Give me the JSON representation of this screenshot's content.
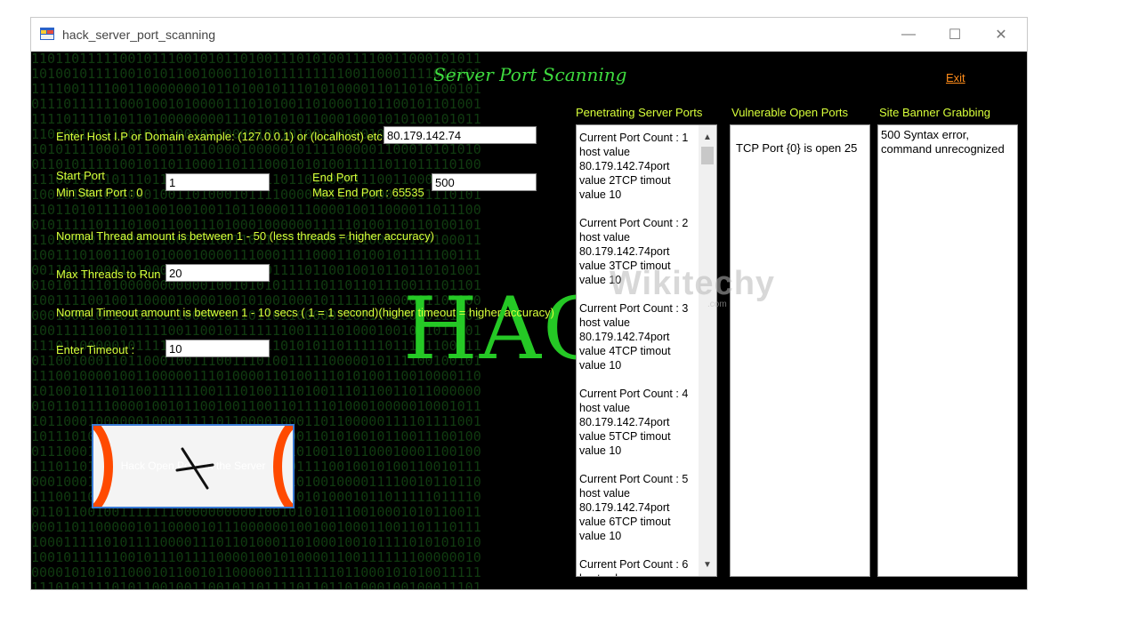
{
  "window": {
    "title": "hack_server_port_scanning",
    "minimize_glyph": "—",
    "maximize_glyph": "☐",
    "close_glyph": "✕",
    "icon": "app-icon"
  },
  "header": {
    "title": "Server Port Scanning",
    "exit_label": "Exit"
  },
  "form": {
    "host_label": "Enter Host I.P or Domain example: (127.0.0.1) or (localhost) etc..",
    "host_value": "80.179.142.74",
    "start_port_label": "Start Port",
    "start_port_hint": "Min Start Port : 0",
    "start_port_value": "1",
    "end_port_label": "End Port",
    "end_port_hint": "Max End Port : 65535",
    "end_port_value": "500",
    "thread_note": "Normal Thread amount is between 1 - 50 (less threads = higher accuracy)",
    "max_threads_label": "Max Threads to Run",
    "max_threads_value": "20",
    "timeout_note": "Normal Timeout amount is between 1 - 10 secs ( 1 = 1 second)(higher timeout = higher accuracy)",
    "timeout_label": "Enter Timeout :",
    "timeout_value": "10"
  },
  "background": {
    "big_text": "HAC",
    "binary_rows": [
      "11011011111001011100101011010011101010011110011000101011",
      "10100101111001010110010001101011111111100110001111010101",
      "11110011110011000000010110100101110101000011011010100101",
      "01110111111000100101000011101010011010001101100101101001",
      "11110111101011010000000011101010101100010001010100101011",
      "11010010111101011100101100001001010011000010111011011010",
      "10101111000101100110110000100000101111000001100010101010",
      "01101011111001011011000110111000101010011111011011110100",
      "11100111110111011011111011010110110110001110011000000011",
      "10010100101100010011010001011110000101111000011111110101",
      "11011010111100100100100110110000111000010011000011011100",
      "01011111011101001100111010001000000111110100110110100101",
      "11010000111101111000111001101111110000101100011110100011",
      "10011101001100101000100001110001111000110100101111100111",
      "00110111000111000100001000110011110110010010110110101001",
      "01010111101000000000001001010101111101101101110011101101",
      "10011110010011000010000100101001000101111110000001100100",
      "00010001011010110110000101101101100000110111010000111101",
      "10011111001011111001100101111111001111010001001001011101",
      "11101100000101111001001110000110101011011111011101100011",
      "01100100011011000100111001110100111110000010111100100101",
      "11100100001001100000111010000110100111010100110010000110",
      "10100101110110011111100111010011101001110110011011000000",
      "01011011110000100101100100110011011110100010000010001011",
      "10110001000000100011111011000010001101100000111101111001",
      "10111010000011101110011011000011001101010010110011100100",
      "01110001000000100110011111010111101001101100010001100100",
      "11101101010111001011100010010110011110010010100110010111",
      "00010001100011111011001111100101101001000011110010110110",
      "11100110001001101001000101101010101010001011011111011110",
      "01101100100111111100000000001001010101110010001010110011",
      "00011011000001011000010111000000100100100011001101110111",
      "10001111101011110000111011010001101000100101111010101010",
      "10010111111001011101111000010010100001100111111100000010",
      "00001010101100010110010110000011111111011000101010011111",
      "11101011110101100100110010110111101101101000100100011101"
    ]
  },
  "scan_button": {
    "label": "Hack Open Ports in the Server",
    "icon": "crosshair-icon"
  },
  "columns": {
    "penetrating_title": "Penetrating Server Ports",
    "vulnerable_title": "Vulnerable Open Ports",
    "banner_title": "Site Banner Grabbing"
  },
  "penetrating_list": [
    {
      "count": "Current Port Count : 1",
      "host": "host value",
      "detail": "80.179.142.74port value 2TCP timout value 10"
    },
    {
      "count": "Current Port Count : 2",
      "host": "host value",
      "detail": "80.179.142.74port value 3TCP timout value 10"
    },
    {
      "count": "Current Port Count : 3",
      "host": "host value",
      "detail": "80.179.142.74port value 4TCP timout value 10"
    },
    {
      "count": "Current Port Count : 4",
      "host": "host value",
      "detail": "80.179.142.74port value 5TCP timout value 10"
    },
    {
      "count": "Current Port Count : 5",
      "host": "host value",
      "detail": "80.179.142.74port value 6TCP timout value 10"
    },
    {
      "count": "Current Port Count : 6",
      "host": "host value",
      "detail": ""
    }
  ],
  "scroll": {
    "up_glyph": "▲",
    "down_glyph": "▼"
  },
  "vulnerable_list": [
    "TCP Port {0} is open 25"
  ],
  "banner_list": [
    "500 Syntax error, command unrecognized"
  ],
  "watermark": {
    "text": "Wikitechy",
    "sub": ".com"
  }
}
